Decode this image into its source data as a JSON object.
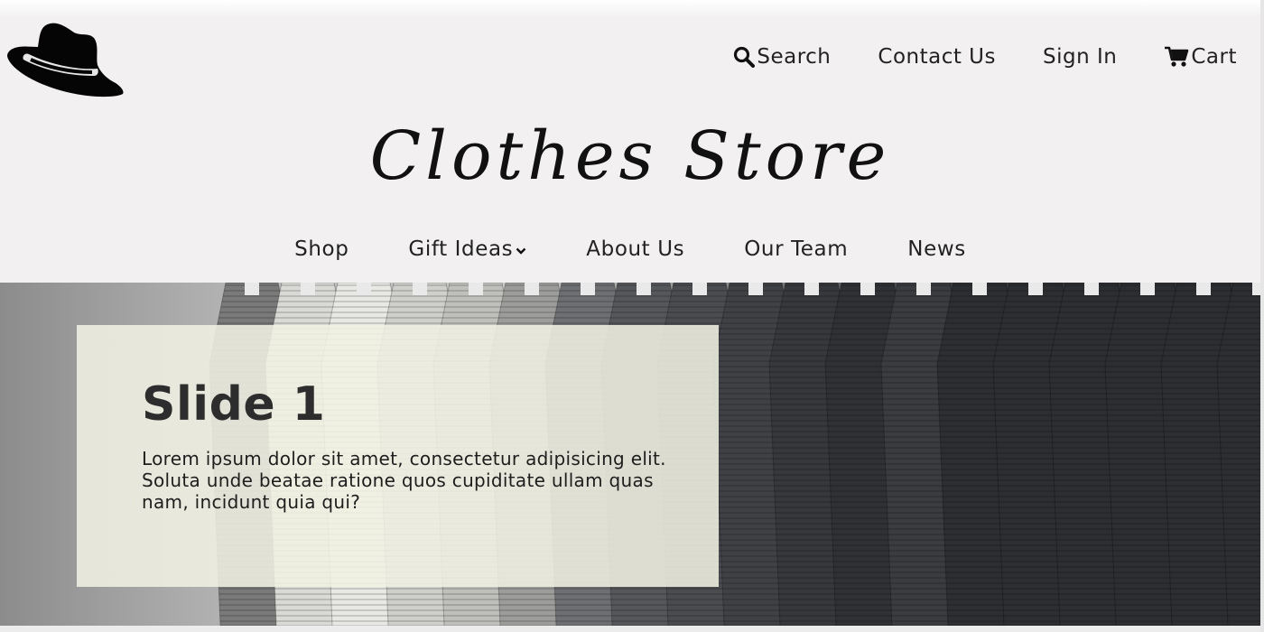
{
  "header": {
    "logo_icon": "cowboy-hat-icon",
    "top_links": {
      "search": {
        "label": "Search",
        "icon": "search-icon"
      },
      "contact": {
        "label": "Contact Us"
      },
      "signin": {
        "label": "Sign In"
      },
      "cart": {
        "label": "Cart",
        "icon": "cart-icon"
      }
    },
    "brand": "Clothes Store",
    "nav": {
      "shop": "Shop",
      "gift_ideas": "Gift Ideas",
      "about": "About Us",
      "team": "Our Team",
      "news": "News"
    }
  },
  "hero": {
    "slide": {
      "title": "Slide 1",
      "text": "Lorem ipsum dolor sit amet, consectetur adipisicing elit. Soluta unde beatae ratione quos cupiditate ullam quas nam, incidunt quia qui?"
    }
  },
  "colors": {
    "header_bg": "#f3f0f1",
    "text": "#222222",
    "slide_box": "#f0f0e2"
  }
}
